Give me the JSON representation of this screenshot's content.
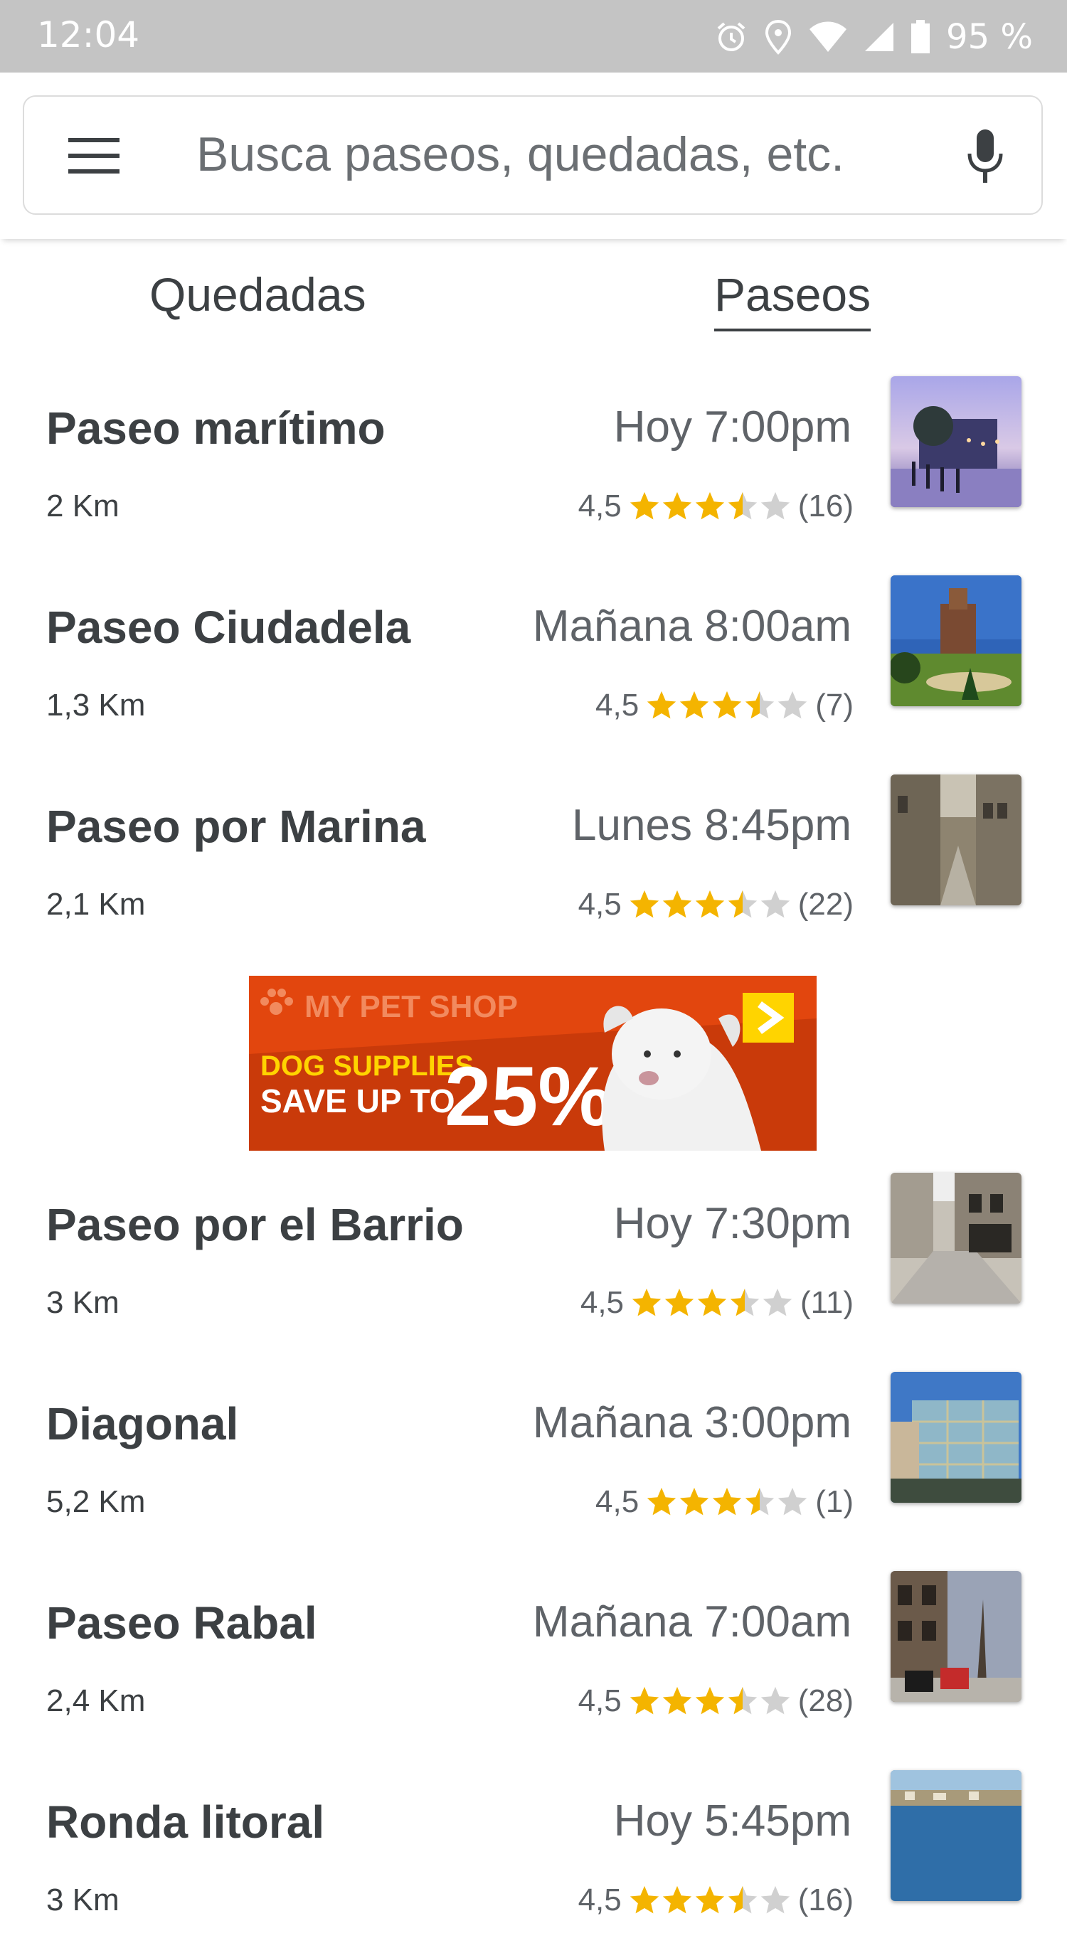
{
  "status_bar": {
    "time": "12:04",
    "battery_text": "95 %",
    "icons": [
      "alarm-icon",
      "location-icon",
      "wifi-icon",
      "signal-icon",
      "battery-icon"
    ]
  },
  "search": {
    "placeholder": "Busca paseos, quedadas, etc.",
    "menu_icon": "menu-icon",
    "mic_icon": "microphone-icon"
  },
  "tabs": [
    {
      "label": "Quedadas",
      "active": false
    },
    {
      "label": "Paseos",
      "active": true
    }
  ],
  "walks": [
    {
      "title": "Paseo marítimo",
      "distance": "2 Km",
      "time": "Hoy 7:00pm",
      "rating_text": "4,5",
      "rating": 3.5,
      "count": "(16)"
    },
    {
      "title": "Paseo Ciudadela",
      "distance": "1,3 Km",
      "time": "Mañana 8:00am",
      "rating_text": "4,5",
      "rating": 3.5,
      "count": "(7)"
    },
    {
      "title": "Paseo por Marina",
      "distance": "2,1 Km",
      "time": "Lunes 8:45pm",
      "rating_text": "4,5",
      "rating": 3.5,
      "count": "(22)"
    },
    {
      "title": "Paseo por el Barrio",
      "distance": "3 Km",
      "time": "Hoy 7:30pm",
      "rating_text": "4,5",
      "rating": 3.5,
      "count": "(11)"
    },
    {
      "title": "Diagonal",
      "distance": "5,2 Km",
      "time": "Mañana 3:00pm",
      "rating_text": "4,5",
      "rating": 3.5,
      "count": "(1)"
    },
    {
      "title": "Paseo Rabal",
      "distance": "2,4 Km",
      "time": "Mañana 7:00am",
      "rating_text": "4,5",
      "rating": 3.5,
      "count": "(28)"
    },
    {
      "title": "Ronda litoral",
      "distance": "3 Km",
      "time": "Hoy 5:45pm",
      "rating_text": "4,5",
      "rating": 3.5,
      "count": "(16)"
    }
  ],
  "ad": {
    "brand": "MY PET SHOP",
    "line1": "DOG SUPPLIES",
    "line2": "SAVE UP TO",
    "percent": "25%"
  },
  "colors": {
    "star": "#f4b400",
    "star_empty": "#d0d0d0",
    "ad_orange": "#e2460e",
    "ad_yellow": "#ffd400"
  }
}
